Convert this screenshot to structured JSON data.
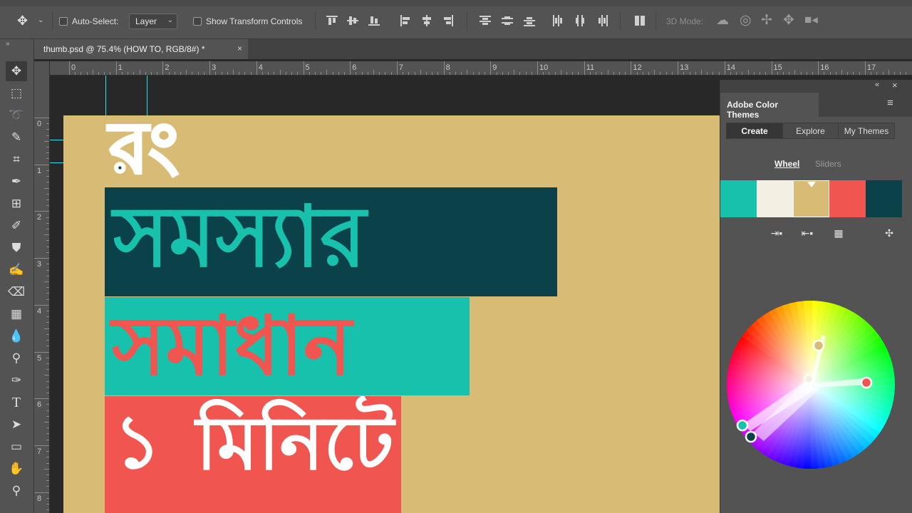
{
  "options_bar": {
    "auto_select_label": "Auto-Select:",
    "auto_select_value": "Layer",
    "show_transform_label": "Show Transform Controls",
    "mode_3d_label": "3D Mode:"
  },
  "document_tab": {
    "title": "thumb.psd @ 75.4% (HOW TO, RGB/8#) *",
    "close_glyph": "×"
  },
  "rulers": {
    "horizontal": [
      "0",
      "1",
      "2",
      "3",
      "4",
      "5",
      "6",
      "7",
      "8",
      "9",
      "10",
      "11",
      "12",
      "13",
      "14",
      "15",
      "16",
      "17"
    ],
    "vertical": [
      "0",
      "1",
      "2",
      "3",
      "4",
      "5",
      "6",
      "7",
      "8"
    ]
  },
  "canvas": {
    "line1": "রং",
    "line2": "সমস্যার",
    "line3": "সমাধান",
    "line4_num": "১",
    "line4_word": "মিনিটে",
    "colors": {
      "background": "#d8bb75",
      "band1": "#0b424a",
      "band2": "#17c1ac",
      "band3": "#f0564f",
      "text_teal": "#17c1ac",
      "text_red": "#f0564f",
      "text_white": "#ffffff"
    }
  },
  "panel": {
    "title": "Adobe Color Themes",
    "tabs": [
      "Create",
      "Explore",
      "My Themes"
    ],
    "subtabs": [
      "Wheel",
      "Sliders"
    ],
    "swatches": [
      "#17c1ac",
      "#f3efe3",
      "#d8bb75",
      "#f0564f",
      "#0b424a"
    ],
    "collapse_glyph": "«",
    "close_glyph": "×",
    "menu_glyph": "≡"
  }
}
